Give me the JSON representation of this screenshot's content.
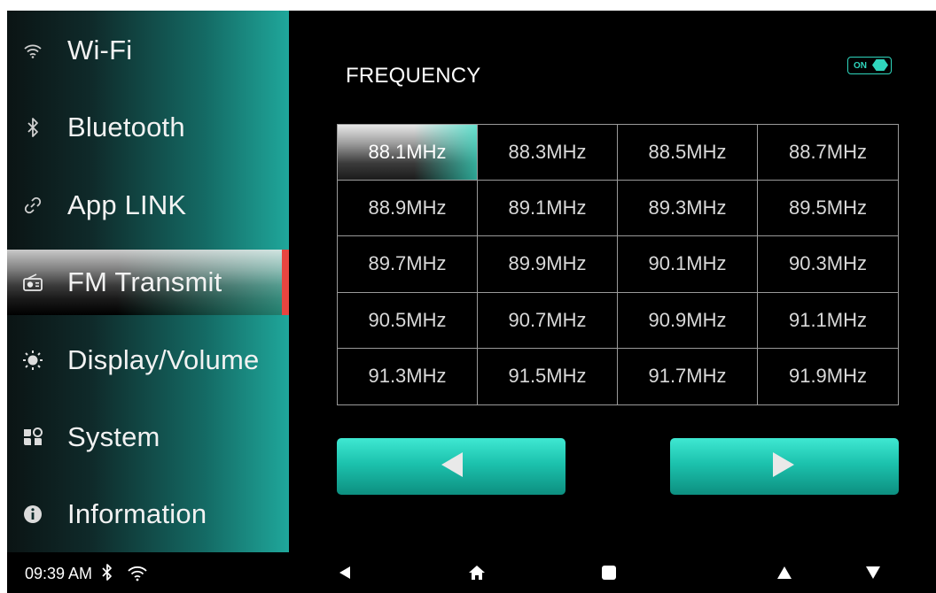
{
  "sidebar": {
    "items": [
      {
        "label": "Wi-Fi",
        "icon": "wifi-icon"
      },
      {
        "label": "Bluetooth",
        "icon": "bluetooth-icon"
      },
      {
        "label": "App LINK",
        "icon": "link-icon"
      },
      {
        "label": "FM Transmit",
        "icon": "radio-icon",
        "active": true
      },
      {
        "label": "Display/Volume",
        "icon": "brightness-icon"
      },
      {
        "label": "System",
        "icon": "system-icon"
      },
      {
        "label": "Information",
        "icon": "info-icon"
      }
    ]
  },
  "main": {
    "title": "FREQUENCY",
    "toggle": {
      "label": "ON",
      "state": "on"
    },
    "frequencies": [
      "88.1MHz",
      "88.3MHz",
      "88.5MHz",
      "88.7MHz",
      "88.9MHz",
      "89.1MHz",
      "89.3MHz",
      "89.5MHz",
      "89.7MHz",
      "89.9MHz",
      "90.1MHz",
      "90.3MHz",
      "90.5MHz",
      "90.7MHz",
      "90.9MHz",
      "91.1MHz",
      "91.3MHz",
      "91.5MHz",
      "91.7MHz",
      "91.9MHz"
    ],
    "selected_frequency": "88.1MHz",
    "prev_button_icon": "triangle-left-icon",
    "next_button_icon": "triangle-right-icon"
  },
  "statusbar": {
    "time": "09:39 AM",
    "icons": [
      "bluetooth-icon",
      "wifi-icon"
    ],
    "soft_keys": [
      "back-icon",
      "home-icon",
      "recent-apps-icon",
      "volume-up-icon",
      "volume-down-icon"
    ]
  },
  "colors": {
    "accent": "#2fd6bd",
    "active_marker": "#e84540",
    "background": "#000000"
  }
}
